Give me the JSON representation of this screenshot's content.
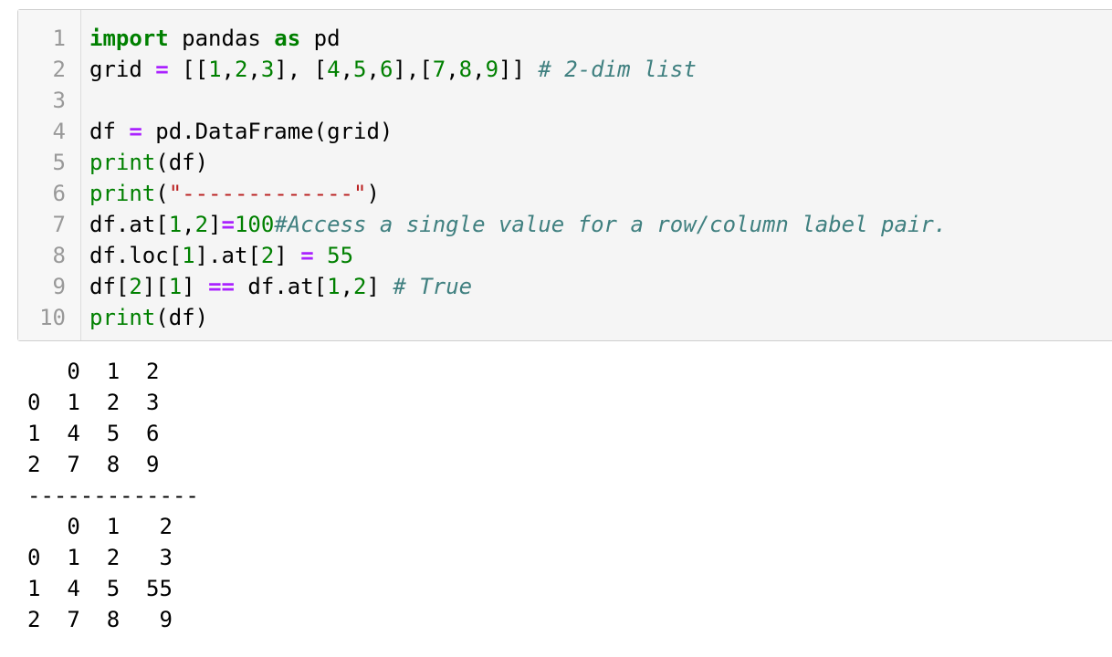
{
  "prompt": ":",
  "code_cell": {
    "lines": [
      {
        "number": "1",
        "tokens": [
          {
            "t": "import",
            "c": "kw"
          },
          {
            "t": " pandas ",
            "c": ""
          },
          {
            "t": "as",
            "c": "kw"
          },
          {
            "t": " pd",
            "c": ""
          }
        ]
      },
      {
        "number": "2",
        "tokens": [
          {
            "t": "grid ",
            "c": ""
          },
          {
            "t": "=",
            "c": "op"
          },
          {
            "t": " [[",
            "c": ""
          },
          {
            "t": "1",
            "c": "num"
          },
          {
            "t": ",",
            "c": ""
          },
          {
            "t": "2",
            "c": "num"
          },
          {
            "t": ",",
            "c": ""
          },
          {
            "t": "3",
            "c": "num"
          },
          {
            "t": "], [",
            "c": ""
          },
          {
            "t": "4",
            "c": "num"
          },
          {
            "t": ",",
            "c": ""
          },
          {
            "t": "5",
            "c": "num"
          },
          {
            "t": ",",
            "c": ""
          },
          {
            "t": "6",
            "c": "num"
          },
          {
            "t": "],[",
            "c": ""
          },
          {
            "t": "7",
            "c": "num"
          },
          {
            "t": ",",
            "c": ""
          },
          {
            "t": "8",
            "c": "num"
          },
          {
            "t": ",",
            "c": ""
          },
          {
            "t": "9",
            "c": "num"
          },
          {
            "t": "]] ",
            "c": ""
          },
          {
            "t": "# 2-dim list",
            "c": "cm"
          }
        ]
      },
      {
        "number": "3",
        "tokens": []
      },
      {
        "number": "4",
        "tokens": [
          {
            "t": "df ",
            "c": ""
          },
          {
            "t": "=",
            "c": "op"
          },
          {
            "t": " pd.DataFrame(grid)",
            "c": ""
          }
        ]
      },
      {
        "number": "5",
        "tokens": [
          {
            "t": "print",
            "c": "bi"
          },
          {
            "t": "(df)",
            "c": ""
          }
        ]
      },
      {
        "number": "6",
        "tokens": [
          {
            "t": "print",
            "c": "bi"
          },
          {
            "t": "(",
            "c": ""
          },
          {
            "t": "\"-------------\"",
            "c": "str"
          },
          {
            "t": ")",
            "c": ""
          }
        ]
      },
      {
        "number": "7",
        "tokens": [
          {
            "t": "df.at[",
            "c": ""
          },
          {
            "t": "1",
            "c": "num"
          },
          {
            "t": ",",
            "c": ""
          },
          {
            "t": "2",
            "c": "num"
          },
          {
            "t": "]",
            "c": ""
          },
          {
            "t": "=",
            "c": "op"
          },
          {
            "t": "100",
            "c": "num"
          },
          {
            "t": "#Access a single value for a row/column label pair.",
            "c": "cm"
          }
        ]
      },
      {
        "number": "8",
        "tokens": [
          {
            "t": "df.loc[",
            "c": ""
          },
          {
            "t": "1",
            "c": "num"
          },
          {
            "t": "].at[",
            "c": ""
          },
          {
            "t": "2",
            "c": "num"
          },
          {
            "t": "] ",
            "c": ""
          },
          {
            "t": "=",
            "c": "op"
          },
          {
            "t": " ",
            "c": ""
          },
          {
            "t": "55",
            "c": "num"
          }
        ]
      },
      {
        "number": "9",
        "tokens": [
          {
            "t": "df[",
            "c": ""
          },
          {
            "t": "2",
            "c": "num"
          },
          {
            "t": "][",
            "c": ""
          },
          {
            "t": "1",
            "c": "num"
          },
          {
            "t": "] ",
            "c": ""
          },
          {
            "t": "==",
            "c": "op"
          },
          {
            "t": " df.at[",
            "c": ""
          },
          {
            "t": "1",
            "c": "num"
          },
          {
            "t": ",",
            "c": ""
          },
          {
            "t": "2",
            "c": "num"
          },
          {
            "t": "] ",
            "c": ""
          },
          {
            "t": "# True",
            "c": "cm"
          }
        ]
      },
      {
        "number": "10",
        "tokens": [
          {
            "t": "print",
            "c": "bi"
          },
          {
            "t": "(df)",
            "c": ""
          }
        ]
      }
    ]
  },
  "output": {
    "lines": [
      "   0  1  2",
      "0  1  2  3",
      "1  4  5  6",
      "2  7  8  9",
      "-------------",
      "   0  1   2",
      "0  1  2   3",
      "1  4  5  55",
      "2  7  8   9"
    ]
  }
}
